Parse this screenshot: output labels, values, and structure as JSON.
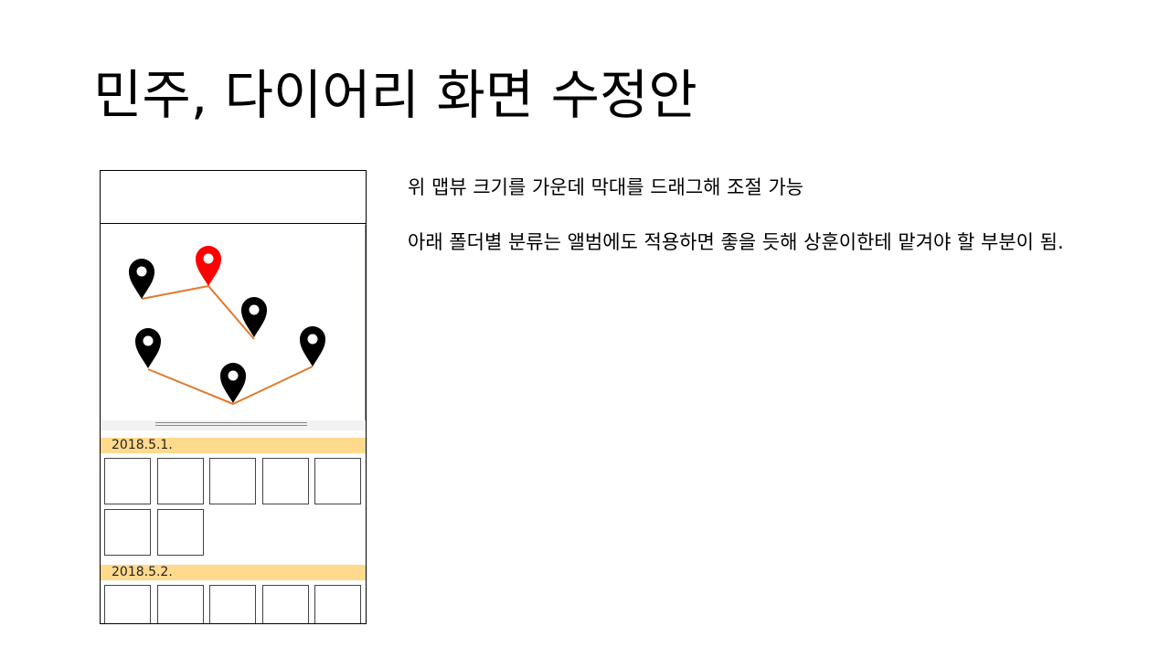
{
  "slide": {
    "title": "민주, 다이어리 화면 수정안"
  },
  "mockup": {
    "groups": [
      {
        "date": "2018.5.1.",
        "photo_count": 7
      },
      {
        "date": "2018.5.2.",
        "photo_count": 5
      }
    ],
    "map": {
      "route_color": "#e07a2e",
      "pin_color": "#000000",
      "selected_pin_color": "#ff0000",
      "pin_count": 6
    }
  },
  "notes": {
    "line1": "위 맵뷰 크기를 가운데 막대를 드래그해 조절 가능",
    "line2": "아래 폴더별 분류는 앨범에도 적용하면 좋을 듯해 상훈이한테 맡겨야 할 부분이 됨."
  }
}
